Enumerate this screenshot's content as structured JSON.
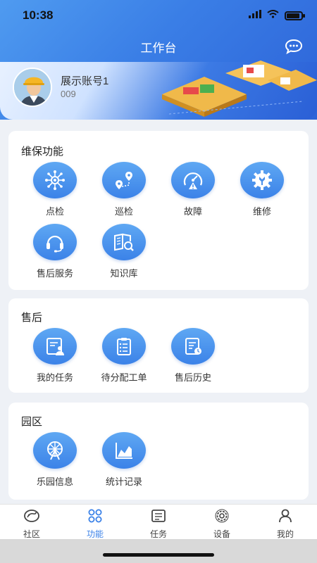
{
  "status": {
    "time": "10:38"
  },
  "header": {
    "title": "工作台"
  },
  "profile": {
    "name": "展示账号1",
    "id": "009"
  },
  "sections": [
    {
      "title": "维保功能",
      "items": [
        {
          "label": "点检",
          "icon": "inspection-network-icon"
        },
        {
          "label": "巡检",
          "icon": "route-pin-icon"
        },
        {
          "label": "故障",
          "icon": "gauge-warning-icon"
        },
        {
          "label": "维修",
          "icon": "gear-wrench-icon"
        },
        {
          "label": "售后服务",
          "icon": "headset-icon"
        },
        {
          "label": "知识库",
          "icon": "book-search-icon"
        }
      ]
    },
    {
      "title": "售后",
      "items": [
        {
          "label": "我的任务",
          "icon": "task-person-icon"
        },
        {
          "label": "待分配工单",
          "icon": "clipboard-list-icon"
        },
        {
          "label": "售后历史",
          "icon": "document-clock-icon"
        }
      ]
    },
    {
      "title": "园区",
      "items": [
        {
          "label": "乐园信息",
          "icon": "ferris-wheel-icon"
        },
        {
          "label": "统计记录",
          "icon": "chart-area-icon"
        }
      ]
    }
  ],
  "tabs": [
    {
      "label": "社区",
      "icon": "community-icon"
    },
    {
      "label": "功能",
      "icon": "grid-icon"
    },
    {
      "label": "任务",
      "icon": "task-list-icon"
    },
    {
      "label": "设备",
      "icon": "device-gear-icon"
    },
    {
      "label": "我的",
      "icon": "person-icon"
    }
  ],
  "colors": {
    "primary": "#3b82e8",
    "header": "#4f9bf0"
  }
}
